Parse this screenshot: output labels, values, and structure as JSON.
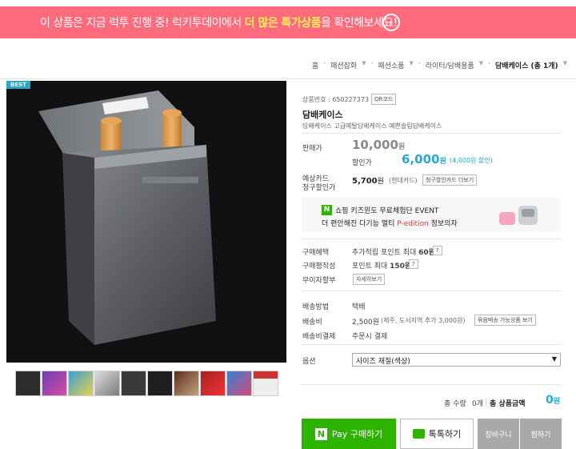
{
  "banner": {
    "text_pre": "이 상품은 지금 럭투 진행 중! 럭키투데이에서 ",
    "text_highlight1": "더 많은 ",
    "text_highlight2": "특가상품",
    "text_post": "을 확인해보세요!",
    "go_icon": "›"
  },
  "breadcrumb": {
    "home": "홈",
    "items": [
      "패션잡화",
      "패션소품",
      "라이터/담배용품"
    ],
    "current": "담배케이스 (총 1개)"
  },
  "product": {
    "badge": "BEST",
    "code_label": "상품번호 : 650227373",
    "qr_label": "QR코드",
    "name": "담배케이스",
    "desc": "담배케이스 고급메탈담배케이스 예쁜슬림담배케이스",
    "price_label": "판매가",
    "price": "10,000",
    "price_unit": "원",
    "discount_label": "할인가",
    "discount_price": "6,000",
    "discount_unit": "원",
    "discount_note": "(4,000원 할인)",
    "card_label_1": "예상카드",
    "card_label_2": "청구할인가",
    "card_price": "5,700",
    "card_unit": "원",
    "card_note": "(현대카드)",
    "card_btn": "청구할인카드 더보기"
  },
  "ad": {
    "line1": "쇼핑 키즈윈도 무료체험단 EVENT",
    "line2_pre": "더 편안해진 다기능 멀티 ",
    "line2_red": "P-edition",
    "line2_post": " 정보의자"
  },
  "benefits": {
    "label1": "구매혜택",
    "value1_pre": "추가적립 포인트 최대 ",
    "value1_num": "60원",
    "label2": "구매평작성",
    "value2_pre": "포인트 최대 ",
    "value2_num": "150원",
    "label3": "무이자할부",
    "value3_btn": "자세히보기",
    "q": "?"
  },
  "shipping": {
    "label1": "배송방법",
    "value1": "택배",
    "label2": "배송비",
    "value2": "2,500원",
    "value2_note": "(제주, 도서지역 추가 3,000원)",
    "value2_btn": "묶음배송 가능상품 보기",
    "label3": "배송비결제",
    "value3": "주문시 결제"
  },
  "option": {
    "label": "옵션",
    "selected": "사이즈 재질(색상)"
  },
  "total": {
    "qty_label": "총 수량",
    "qty_value": "0개",
    "amount_label": "총 상품금액",
    "amount": "0",
    "amount_unit": "원"
  },
  "buttons": {
    "pay_n": "N",
    "pay": "Pay 구매하기",
    "talk": "톡톡하기",
    "cart": "장바구니",
    "wish": "찜하기"
  }
}
